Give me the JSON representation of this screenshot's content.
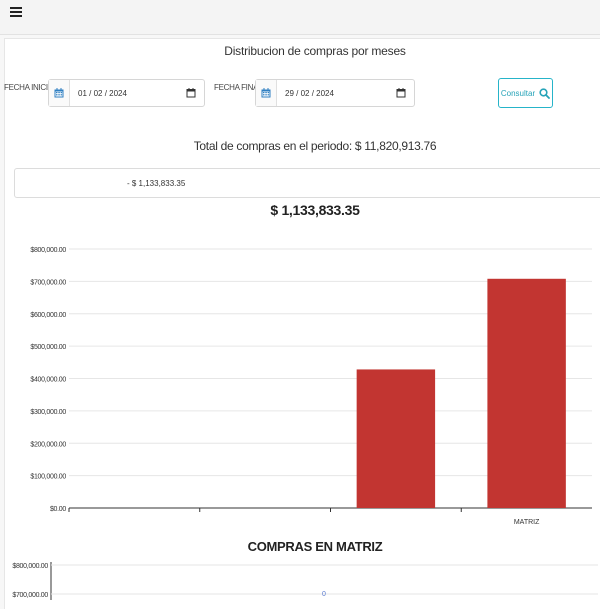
{
  "header": {
    "menu_icon": "hamburger-icon"
  },
  "page": {
    "title": "Distribucion de compras por meses"
  },
  "filters": {
    "fecha_inicial_label": "FECHA INICIAL",
    "fecha_inicial_value": "01 / 02 / 2024",
    "fecha_final_label": "FECHA FINAL",
    "fecha_final_value": "29 / 02 / 2024",
    "consultar_label": "Consultar"
  },
  "summary": {
    "total_text": "Total de compras en el periodo: $ 11,820,913.76"
  },
  "branch_select": {
    "selected": "- $ 1,133,833.35"
  },
  "colors": {
    "bar": "#c23531",
    "accent": "#26b4c9",
    "gridline": "#e6e6e6"
  },
  "chart_data": [
    {
      "type": "bar",
      "title": "$ 1,133,833.35",
      "categories": [
        "",
        "",
        "",
        "MATRIZ"
      ],
      "values": [
        0,
        0,
        428000,
        708000
      ],
      "ylim": [
        0,
        800000
      ],
      "y_ticks": [
        "$0.00",
        "$100,000.00",
        "$200,000.00",
        "$300,000.00",
        "$400,000.00",
        "$500,000.00",
        "$600,000.00",
        "$700,000.00",
        "$800,000.00"
      ],
      "grid": true,
      "color": "#c23531"
    },
    {
      "type": "line",
      "title": "COMPRAS EN MATRIZ",
      "y_ticks_visible": [
        "$800,000.00",
        "$700,000.00"
      ],
      "ylim": [
        0,
        800000
      ],
      "visible_point": {
        "label": "0"
      }
    }
  ]
}
